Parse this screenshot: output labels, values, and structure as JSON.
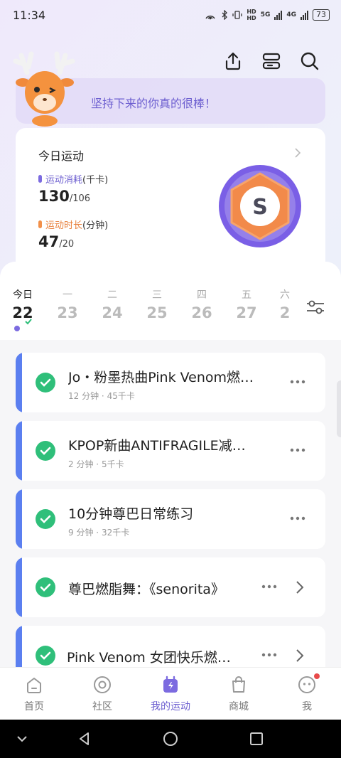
{
  "status_bar": {
    "time": "11:34",
    "hd1": "HD",
    "hd2": "HD",
    "net1": "5G",
    "net2": "4G",
    "battery": "73"
  },
  "banner": {
    "text": "坚持下来的你真的很棒！"
  },
  "stats": {
    "title": "今日运动",
    "calories": {
      "label": "运动消耗",
      "unit": "(千卡)",
      "value": "130",
      "goal": "/106"
    },
    "duration": {
      "label": "运动时长",
      "unit": "(分钟)",
      "value": "47",
      "goal": "/20"
    },
    "badge_letter": "S"
  },
  "week": {
    "days": [
      {
        "name": "今日",
        "date": "22"
      },
      {
        "name": "一",
        "date": "23"
      },
      {
        "name": "二",
        "date": "24"
      },
      {
        "name": "三",
        "date": "25"
      },
      {
        "name": "四",
        "date": "26"
      },
      {
        "name": "五",
        "date": "27"
      },
      {
        "name": "六",
        "date": "2"
      }
    ]
  },
  "items": [
    {
      "title": "Jo・粉墨热曲Pink Venom燃…",
      "minutes": "12 分钟",
      "calories": "45千卡"
    },
    {
      "title": "KPOP新曲ANTIFRAGILE减…",
      "minutes": "2 分钟",
      "calories": "5千卡"
    },
    {
      "title": "10分钟尊巴日常练习",
      "minutes": "9 分钟",
      "calories": "32千卡"
    },
    {
      "title": "尊巴燃脂舞：《senorita》"
    },
    {
      "title": "Pink Venom 女团快乐燃…"
    }
  ],
  "meta_sep": "·",
  "nav": [
    {
      "label": "首页",
      "icon": "home-icon"
    },
    {
      "label": "社区",
      "icon": "community-icon"
    },
    {
      "label": "我的运动",
      "icon": "my-sport-icon"
    },
    {
      "label": "商城",
      "icon": "shop-icon"
    },
    {
      "label": "我",
      "icon": "profile-icon"
    }
  ],
  "colors": {
    "accent": "#6d5fd0",
    "orange": "#e8803c",
    "check": "#2fbf7a",
    "item_bar": "#5b7ff0"
  }
}
